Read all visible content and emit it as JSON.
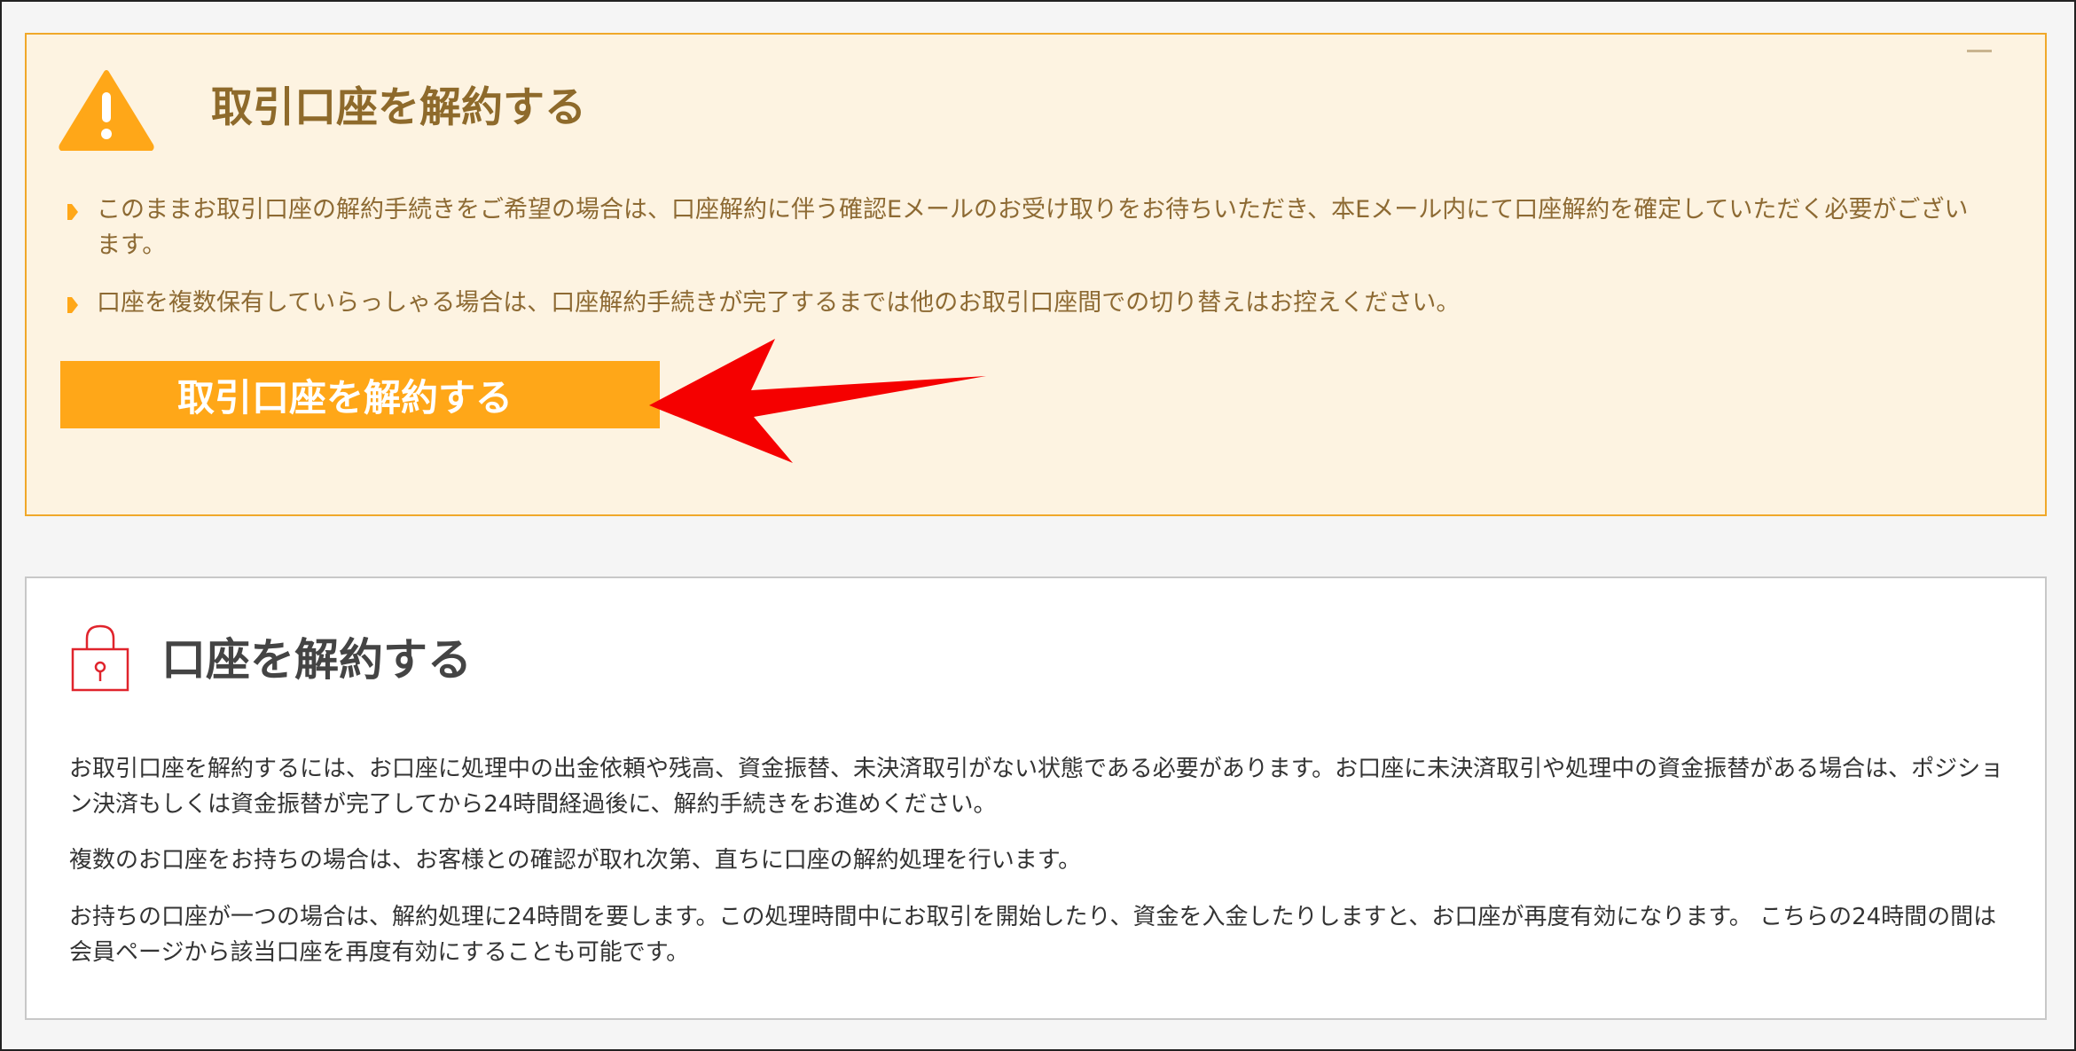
{
  "warning": {
    "title": "取引口座を解約する",
    "notices": [
      "このままお取引口座の解約手続きをご希望の場合は、口座解約に伴う確認Eメールのお受け取りをお待ちいただき、本Eメール内にて口座解約を確定していただく必要がございます。",
      "口座を複数保有していらっしゃる場合は、口座解約手続きが完了するまでは他のお取引口座間での切り替えはお控えください。"
    ],
    "button_label": "取引口座を解約する"
  },
  "info": {
    "title": "口座を解約する",
    "paragraphs": [
      "お取引口座を解約するには、お口座に処理中の出金依頼や残高、資金振替、未決済取引がない状態である必要があります。お口座に未決済取引や処理中の資金振替がある場合は、ポジション決済もしくは資金振替が完了してから24時間経過後に、解約手続きをお進めください。",
      "複数のお口座をお持ちの場合は、お客様との確認が取れ次第、直ちに口座の解約処理を行います。",
      "お持ちの口座が一つの場合は、解約処理に24時間を要します。この処理時間中にお取引を開始したり、資金を入金したりしますと、お口座が再度有効になります。 こちらの24時間の間は会員ページから該当口座を再度有効にすることも可能です。"
    ]
  },
  "icons": {
    "warning": "warning-triangle-icon",
    "bullet": "bullet-arrow-icon",
    "lock": "lock-icon",
    "collapse": "collapse-icon",
    "annotation": "red-pointer-arrow"
  },
  "colors": {
    "warning_background": "#fdf3e1",
    "warning_border": "#f0a82a",
    "accent": "#ffa718",
    "warning_text": "#8d6a33",
    "lock_red": "#e0242c",
    "annotation_red": "#f50000"
  }
}
